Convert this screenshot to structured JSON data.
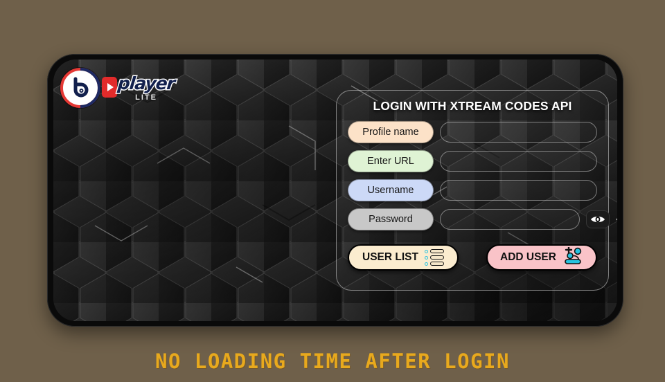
{
  "background_color": "#6f604a",
  "brand": {
    "badge_letter": "b",
    "badge_colors": {
      "ring_left": "#e53935",
      "ring_right": "#1d2a63",
      "face": "#ffffff"
    },
    "play_icon": "play-triangle-icon",
    "word_primary": "player",
    "word_secondary": "LITE"
  },
  "login_panel": {
    "title": "LOGIN WITH XTREAM CODES API",
    "fields": [
      {
        "label": "Profile name",
        "value": "",
        "placeholder": "",
        "pill_color": "#fce2c8",
        "name": "profile-name"
      },
      {
        "label": "Enter URL",
        "value": "",
        "placeholder": "",
        "pill_color": "#dff3d4",
        "name": "url"
      },
      {
        "label": "Username",
        "value": "",
        "placeholder": "",
        "pill_color": "#ccd9f7",
        "name": "username"
      },
      {
        "label": "Password",
        "value": "",
        "placeholder": "",
        "pill_color": "#c8c8c8",
        "name": "password"
      }
    ],
    "password_toggles": {
      "show_icon": "eye-icon",
      "hide_icon": "eye-off-icon"
    },
    "buttons": [
      {
        "label": "USER LIST",
        "icon": "list-icon",
        "color": "#fbeccf",
        "name": "user-list"
      },
      {
        "label": "ADD USER",
        "icon": "add-user-icon",
        "color": "#f9c3c8",
        "name": "add-user"
      }
    ]
  },
  "caption": {
    "text": "NO LOADING TIME AFTER LOGIN",
    "color": "#e8a91d"
  }
}
